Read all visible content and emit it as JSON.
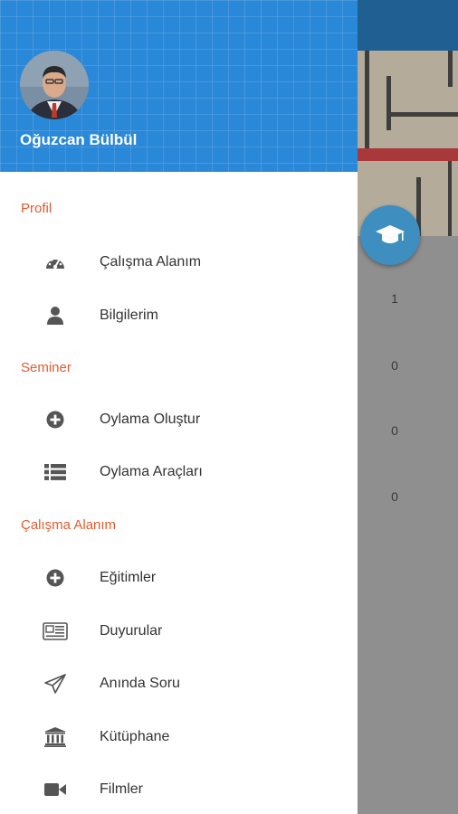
{
  "user": {
    "name": "Oğuzcan Bülbül"
  },
  "sections": [
    {
      "title": "Profil",
      "items": [
        {
          "label": "Çalışma Alanım",
          "icon": "dashboard-icon"
        },
        {
          "label": "Bilgilerim",
          "icon": "user-icon"
        }
      ]
    },
    {
      "title": "Seminer",
      "items": [
        {
          "label": "Oylama Oluştur",
          "icon": "plus-circle-icon"
        },
        {
          "label": "Oylama Araçları",
          "icon": "list-icon"
        }
      ]
    },
    {
      "title": "Çalışma Alanım",
      "items": [
        {
          "label": "Eğitimler",
          "icon": "plus-circle-icon"
        },
        {
          "label": "Duyurular",
          "icon": "newspaper-icon"
        },
        {
          "label": "Anında Soru",
          "icon": "send-icon"
        },
        {
          "label": "Kütüphane",
          "icon": "bank-icon"
        },
        {
          "label": "Filmler",
          "icon": "video-icon"
        }
      ]
    }
  ],
  "background": {
    "counts": [
      "1",
      "0",
      "0",
      "0"
    ]
  },
  "colors": {
    "header": "#2a88d8",
    "section_title": "#e35b2e",
    "icon": "#555555",
    "fab": "#3e8ec0"
  }
}
